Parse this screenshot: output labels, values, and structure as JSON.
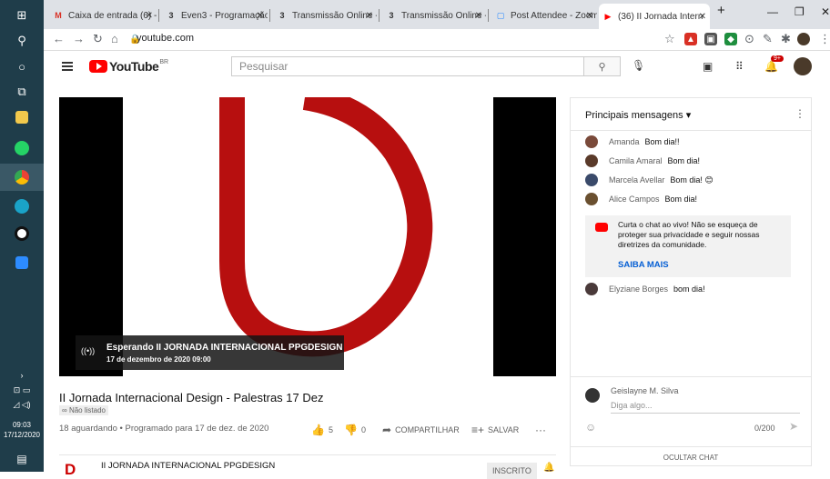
{
  "taskbar": {
    "time": "09:03",
    "date": "17/12/2020"
  },
  "tabs": [
    {
      "label": "Caixa de entrada (6) -",
      "favicon": "gmail-icon",
      "fav_glyph": "M",
      "fav_color": "#d93025"
    },
    {
      "label": "Even3 - Programação",
      "favicon": "even3-icon",
      "fav_glyph": "3",
      "fav_color": "#222"
    },
    {
      "label": "Transmissão Online -",
      "favicon": "even3-icon",
      "fav_glyph": "3",
      "fav_color": "#222"
    },
    {
      "label": "Transmissão Online -",
      "favicon": "even3-icon",
      "fav_glyph": "3",
      "fav_color": "#222"
    },
    {
      "label": "Post Attendee - Zoom",
      "favicon": "zoom-icon",
      "fav_glyph": "▢",
      "fav_color": "#2d8cff"
    },
    {
      "label": "(36) II Jornada Intern",
      "favicon": "youtube-icon",
      "fav_glyph": "▶",
      "fav_color": "#ff0000"
    }
  ],
  "address": {
    "url": "youtube.com"
  },
  "youtube": {
    "logo_text": "YouTube",
    "region": "BR",
    "search_placeholder": "Pesquisar",
    "notifications": "9+"
  },
  "video": {
    "live_title": "Esperando II JORNADA INTERNACIONAL PPGDESIGN",
    "live_date": "17 de dezembro de 2020 09:00",
    "title": "II Jornada Internacional Design - Palestras 17 Dez",
    "unlisted": "Não listado",
    "meta": "18 aguardando • Programado para 17 de dez. de 2020",
    "likes": "5",
    "dislikes": "0",
    "share": "COMPARTILHAR",
    "save": "SALVAR",
    "channel": "II JORNADA INTERNACIONAL PPGDESIGN",
    "subscribed": "INSCRITO"
  },
  "chat": {
    "header": "Principais mensagens",
    "messages": [
      {
        "author": "Amanda",
        "text": "Bom dia!!",
        "color": "#7a4a3a"
      },
      {
        "author": "Camila Amaral",
        "text": "Bom dia!",
        "color": "#5a3a2a"
      },
      {
        "author": "Marcela Avellar",
        "text": "Bom dia! 😊",
        "color": "#3a4a6a"
      },
      {
        "author": "Alice Campos",
        "text": "Bom dia!",
        "color": "#6a5030"
      }
    ],
    "notice": "Curta o chat ao vivo! Não se esqueça de proteger sua privacidade e seguir nossas diretrizes da comunidade.",
    "notice_link": "SAIBA MAIS",
    "late_message": {
      "author": "Elyziane Borges",
      "text": "bom dia!",
      "color": "#4a3a3a"
    },
    "input_user": "Geislayne M. Silva",
    "input_placeholder": "Diga algo...",
    "char_count": "0/200",
    "hide_chat": "OCULTAR CHAT"
  }
}
